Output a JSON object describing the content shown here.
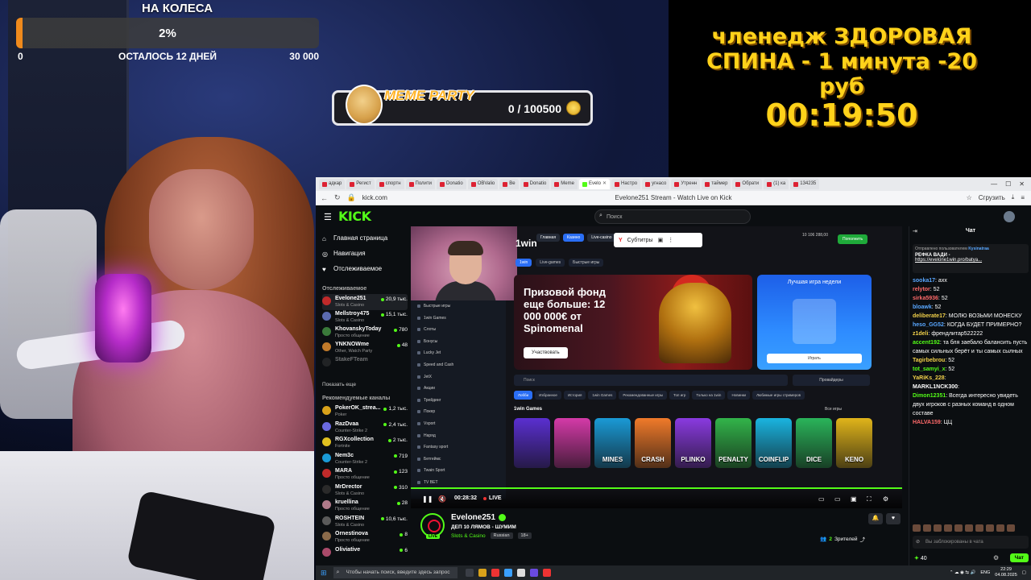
{
  "goal": {
    "title": "НА КОЛЕСА",
    "percent_label": "2%",
    "progress": 0.02,
    "min": "0",
    "days_left": "ОСТАЛОСЬ 12 ДНЕЙ",
    "max": "30 000",
    "fill_color": "#f08a1c"
  },
  "challenge": {
    "line1": "членедж ЗДОРОВАЯ",
    "line2": "СПИНА - 1 минута -20 руб",
    "timer": "00:19:50",
    "color": "#ffd21a"
  },
  "meme_party": {
    "title": "MEME PARTY",
    "count": "0 / 100500"
  },
  "browser": {
    "tabs": [
      "адкар",
      "Регист",
      "спортн",
      "Полити",
      "Donatio",
      "OBValio",
      "Ве",
      "Donatio",
      "Meme",
      "Evelo",
      "Настро",
      "угнасо",
      "Утренн",
      "таймер",
      "Обрати",
      "(1) ка",
      "134235"
    ],
    "active_tab": "Evelo",
    "url": "kick.com",
    "page_title": "Evelone251 Stream - Watch Live on Kick",
    "share_label": "Сгрузить"
  },
  "kick": {
    "logo": "KICK",
    "search_placeholder": "Поиск",
    "nav": {
      "home": "Главная страница",
      "browse": "Навигация",
      "following": "Отслеживаемое"
    },
    "following_title": "Отслеживаемое",
    "show_more": "Показать еще",
    "recommended_title": "Рекомендуемые каналы",
    "following_channels": [
      {
        "name": "Evelone251",
        "category": "Slots & Casino",
        "viewers": "20,9 тыс."
      },
      {
        "name": "Mellstroy475",
        "category": "Slots & Casino",
        "viewers": "15,1 тыс."
      },
      {
        "name": "KhovanskyToday",
        "category": "Просто общение",
        "viewers": "780"
      },
      {
        "name": "YNKNOWme",
        "category": "Other, Watch Party",
        "viewers": "48"
      },
      {
        "name": "StakeFTeam",
        "category": "",
        "viewers": ""
      }
    ],
    "recommended_channels": [
      {
        "name": "PokerOK_strea...",
        "category": "Poker",
        "viewers": "1,2 тыс."
      },
      {
        "name": "RazDvaa",
        "category": "Counter-Strike 2",
        "viewers": "2,4 тыс."
      },
      {
        "name": "RGXcollection",
        "category": "Fortnite",
        "viewers": "2 тыс."
      },
      {
        "name": "Nem3c",
        "category": "Counter-Strike 2",
        "viewers": "719"
      },
      {
        "name": "MARA",
        "category": "Просто общение",
        "viewers": "123"
      },
      {
        "name": "MrDrector",
        "category": "Slots & Casino",
        "viewers": "310"
      },
      {
        "name": "kruellina",
        "category": "Просто общение",
        "viewers": "28"
      },
      {
        "name": "ROSHTEIN",
        "category": "Slots & Casino",
        "viewers": "10,6 тыс."
      },
      {
        "name": "Ornestinova",
        "category": "Просто общение",
        "viewers": "8"
      },
      {
        "name": "Oliviative",
        "category": "",
        "viewers": "6"
      }
    ]
  },
  "video": {
    "subtitles_label": "Субтитры",
    "time": "00:28:32",
    "live_label": "LIVE",
    "casino": {
      "logo": "1win",
      "nav_pills": [
        "Главная",
        "Казино",
        "Live-casino"
      ],
      "tabs": [
        "1win",
        "Live-games",
        "Быстрые игры"
      ],
      "balance": "10 106 288,00",
      "deposit": "Пополнить",
      "sidebar": [
        "Быстрые игры",
        "1win Games",
        "Слоты",
        "Бонусы",
        "Lucky Jet",
        "Speed and Cash",
        "JetX",
        "Акции",
        "Трейдинг",
        "Покер",
        "Vsport",
        "Наряд",
        "Fantasy sport",
        "Бетгеймс",
        "Twain Sport",
        "TV BET"
      ],
      "banner_text": "Призовой фонд еще больше: 12 000 000€ от Spinomenal",
      "banner_button": "Участвовать",
      "card_title": "Лучшая игра недели",
      "card_button": "Играть",
      "search_placeholder": "Поиск",
      "providers": "Провайдеры",
      "filters": [
        "Лобби",
        "Избранное",
        "История",
        "1win Games",
        "Рекомендованные игры",
        "Топ игр",
        "Только на 1win",
        "Новинки",
        "Любимые игры стримеров"
      ],
      "section_title": "1win Games",
      "all_label": "Все игры",
      "games": [
        {
          "label": "",
          "color": "#5a2fd0"
        },
        {
          "label": "",
          "color": "#d43aa8"
        },
        {
          "label": "MINES",
          "color": "#1a9ad6"
        },
        {
          "label": "CRASH",
          "color": "#f07a2a"
        },
        {
          "label": "PLINKO",
          "color": "#8a3ae0"
        },
        {
          "label": "PENALTY",
          "color": "#32b44a"
        },
        {
          "label": "COINFLIP",
          "color": "#1ab4e0"
        },
        {
          "label": "DICE",
          "color": "#2ab45a"
        },
        {
          "label": "KENO",
          "color": "#e0b41a"
        }
      ]
    }
  },
  "stream_info": {
    "live_badge": "LIVE",
    "name": "Evelone251",
    "title": "ДЕП 10 ЛЯМОВ - ШУМИМ",
    "category": "Slots & Casino",
    "tag1": "Russian",
    "tag2": "18+",
    "viewer_icon_count": "2",
    "viewers_label": "Зрителей"
  },
  "chat": {
    "title": "Чат",
    "pinned_by_prefix": "Отправлено пользователем",
    "pinned_by_user": "Kysinatraa",
    "pinned_title": "РЕФКА ВАДИ -",
    "pinned_link": "https://evelone1win.pro/batya...",
    "messages": [
      {
        "user": "sooka17",
        "color": "#59a7ff",
        "text": "ахх"
      },
      {
        "user": "relytor",
        "color": "#ff6a6a",
        "text": "52"
      },
      {
        "user": "sirka5936",
        "color": "#ff6a6a",
        "text": "52"
      },
      {
        "user": "bloawk",
        "color": "#59a7ff",
        "text": "52"
      },
      {
        "user": "deliberate17",
        "color": "#f0d04a",
        "text": "МОЛЮ ВОЗЬМИ МОНЕСКУ"
      },
      {
        "user": "heso_GG52",
        "color": "#59a7ff",
        "text": "КОГДА БУДЕТ ПРИМЕРНО?"
      },
      {
        "user": "z1deli",
        "color": "#f0d04a",
        "text": "френдлитар522222"
      },
      {
        "user": "accent192",
        "color": "#53fc18",
        "text": "та бля заебало балансить пусть самых сильных берёт и ты самых сылных"
      },
      {
        "user": "Tagirbebrou",
        "color": "#f0d04a",
        "text": "52"
      },
      {
        "user": "tot_samyi_x",
        "color": "#53fc18",
        "text": "52"
      },
      {
        "user": "YaRiKs_228",
        "color": "#f0d04a",
        "text": ""
      },
      {
        "user": "MARKL1NCK300",
        "color": "#ffffff",
        "text": ""
      },
      {
        "user": "Dimon12351",
        "color": "#53fc18",
        "text": "Всегда интересно увидеть двух игроков с разных команд в одном составе"
      },
      {
        "user": "HALVA159",
        "color": "#ff6a6a",
        "text": "ЦЦ"
      }
    ],
    "input_placeholder": "Вы заблокированы в чата",
    "points": "40",
    "send_button": "Чат"
  },
  "taskbar": {
    "search_placeholder": "Чтобы начать поиск, введите здесь запрос",
    "lang": "ENG",
    "time": "22:29",
    "date": "04.08.2025"
  }
}
